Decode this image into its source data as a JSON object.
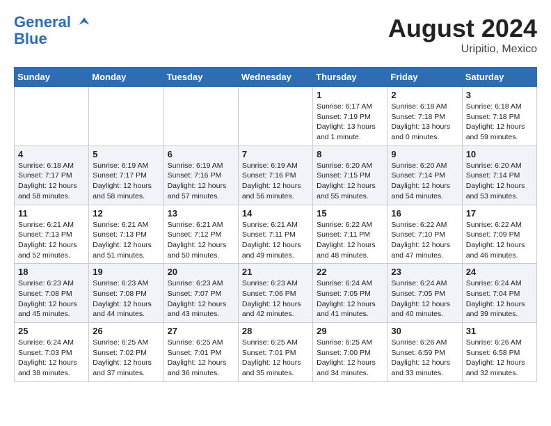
{
  "header": {
    "logo_line1": "General",
    "logo_line2": "Blue",
    "month_year": "August 2024",
    "location": "Uripitio, Mexico"
  },
  "days_of_week": [
    "Sunday",
    "Monday",
    "Tuesday",
    "Wednesday",
    "Thursday",
    "Friday",
    "Saturday"
  ],
  "weeks": [
    [
      {
        "day": "",
        "sunrise": "",
        "sunset": "",
        "daylight": ""
      },
      {
        "day": "",
        "sunrise": "",
        "sunset": "",
        "daylight": ""
      },
      {
        "day": "",
        "sunrise": "",
        "sunset": "",
        "daylight": ""
      },
      {
        "day": "",
        "sunrise": "",
        "sunset": "",
        "daylight": ""
      },
      {
        "day": "1",
        "sunrise": "Sunrise: 6:17 AM",
        "sunset": "Sunset: 7:19 PM",
        "daylight": "Daylight: 13 hours and 1 minute."
      },
      {
        "day": "2",
        "sunrise": "Sunrise: 6:18 AM",
        "sunset": "Sunset: 7:18 PM",
        "daylight": "Daylight: 13 hours and 0 minutes."
      },
      {
        "day": "3",
        "sunrise": "Sunrise: 6:18 AM",
        "sunset": "Sunset: 7:18 PM",
        "daylight": "Daylight: 12 hours and 59 minutes."
      }
    ],
    [
      {
        "day": "4",
        "sunrise": "Sunrise: 6:18 AM",
        "sunset": "Sunset: 7:17 PM",
        "daylight": "Daylight: 12 hours and 58 minutes."
      },
      {
        "day": "5",
        "sunrise": "Sunrise: 6:19 AM",
        "sunset": "Sunset: 7:17 PM",
        "daylight": "Daylight: 12 hours and 58 minutes."
      },
      {
        "day": "6",
        "sunrise": "Sunrise: 6:19 AM",
        "sunset": "Sunset: 7:16 PM",
        "daylight": "Daylight: 12 hours and 57 minutes."
      },
      {
        "day": "7",
        "sunrise": "Sunrise: 6:19 AM",
        "sunset": "Sunset: 7:16 PM",
        "daylight": "Daylight: 12 hours and 56 minutes."
      },
      {
        "day": "8",
        "sunrise": "Sunrise: 6:20 AM",
        "sunset": "Sunset: 7:15 PM",
        "daylight": "Daylight: 12 hours and 55 minutes."
      },
      {
        "day": "9",
        "sunrise": "Sunrise: 6:20 AM",
        "sunset": "Sunset: 7:14 PM",
        "daylight": "Daylight: 12 hours and 54 minutes."
      },
      {
        "day": "10",
        "sunrise": "Sunrise: 6:20 AM",
        "sunset": "Sunset: 7:14 PM",
        "daylight": "Daylight: 12 hours and 53 minutes."
      }
    ],
    [
      {
        "day": "11",
        "sunrise": "Sunrise: 6:21 AM",
        "sunset": "Sunset: 7:13 PM",
        "daylight": "Daylight: 12 hours and 52 minutes."
      },
      {
        "day": "12",
        "sunrise": "Sunrise: 6:21 AM",
        "sunset": "Sunset: 7:13 PM",
        "daylight": "Daylight: 12 hours and 51 minutes."
      },
      {
        "day": "13",
        "sunrise": "Sunrise: 6:21 AM",
        "sunset": "Sunset: 7:12 PM",
        "daylight": "Daylight: 12 hours and 50 minutes."
      },
      {
        "day": "14",
        "sunrise": "Sunrise: 6:21 AM",
        "sunset": "Sunset: 7:11 PM",
        "daylight": "Daylight: 12 hours and 49 minutes."
      },
      {
        "day": "15",
        "sunrise": "Sunrise: 6:22 AM",
        "sunset": "Sunset: 7:11 PM",
        "daylight": "Daylight: 12 hours and 48 minutes."
      },
      {
        "day": "16",
        "sunrise": "Sunrise: 6:22 AM",
        "sunset": "Sunset: 7:10 PM",
        "daylight": "Daylight: 12 hours and 47 minutes."
      },
      {
        "day": "17",
        "sunrise": "Sunrise: 6:22 AM",
        "sunset": "Sunset: 7:09 PM",
        "daylight": "Daylight: 12 hours and 46 minutes."
      }
    ],
    [
      {
        "day": "18",
        "sunrise": "Sunrise: 6:23 AM",
        "sunset": "Sunset: 7:08 PM",
        "daylight": "Daylight: 12 hours and 45 minutes."
      },
      {
        "day": "19",
        "sunrise": "Sunrise: 6:23 AM",
        "sunset": "Sunset: 7:08 PM",
        "daylight": "Daylight: 12 hours and 44 minutes."
      },
      {
        "day": "20",
        "sunrise": "Sunrise: 6:23 AM",
        "sunset": "Sunset: 7:07 PM",
        "daylight": "Daylight: 12 hours and 43 minutes."
      },
      {
        "day": "21",
        "sunrise": "Sunrise: 6:23 AM",
        "sunset": "Sunset: 7:06 PM",
        "daylight": "Daylight: 12 hours and 42 minutes."
      },
      {
        "day": "22",
        "sunrise": "Sunrise: 6:24 AM",
        "sunset": "Sunset: 7:05 PM",
        "daylight": "Daylight: 12 hours and 41 minutes."
      },
      {
        "day": "23",
        "sunrise": "Sunrise: 6:24 AM",
        "sunset": "Sunset: 7:05 PM",
        "daylight": "Daylight: 12 hours and 40 minutes."
      },
      {
        "day": "24",
        "sunrise": "Sunrise: 6:24 AM",
        "sunset": "Sunset: 7:04 PM",
        "daylight": "Daylight: 12 hours and 39 minutes."
      }
    ],
    [
      {
        "day": "25",
        "sunrise": "Sunrise: 6:24 AM",
        "sunset": "Sunset: 7:03 PM",
        "daylight": "Daylight: 12 hours and 38 minutes."
      },
      {
        "day": "26",
        "sunrise": "Sunrise: 6:25 AM",
        "sunset": "Sunset: 7:02 PM",
        "daylight": "Daylight: 12 hours and 37 minutes."
      },
      {
        "day": "27",
        "sunrise": "Sunrise: 6:25 AM",
        "sunset": "Sunset: 7:01 PM",
        "daylight": "Daylight: 12 hours and 36 minutes."
      },
      {
        "day": "28",
        "sunrise": "Sunrise: 6:25 AM",
        "sunset": "Sunset: 7:01 PM",
        "daylight": "Daylight: 12 hours and 35 minutes."
      },
      {
        "day": "29",
        "sunrise": "Sunrise: 6:25 AM",
        "sunset": "Sunset: 7:00 PM",
        "daylight": "Daylight: 12 hours and 34 minutes."
      },
      {
        "day": "30",
        "sunrise": "Sunrise: 6:26 AM",
        "sunset": "Sunset: 6:59 PM",
        "daylight": "Daylight: 12 hours and 33 minutes."
      },
      {
        "day": "31",
        "sunrise": "Sunrise: 6:26 AM",
        "sunset": "Sunset: 6:58 PM",
        "daylight": "Daylight: 12 hours and 32 minutes."
      }
    ]
  ]
}
